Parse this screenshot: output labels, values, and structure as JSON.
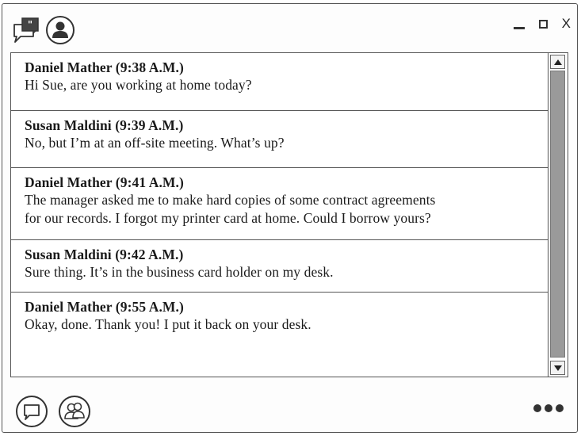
{
  "titlebar": {
    "chat_icon": "speech-bubble-quote-icon",
    "profile_icon": "user-profile-icon",
    "minimize_icon": "minimize-icon",
    "maximize_icon": "maximize-icon",
    "close_label": "X"
  },
  "messages": [
    {
      "sender": "Daniel Mather (9:38 A.M.)",
      "lines": [
        "Hi Sue, are you working at home today?"
      ]
    },
    {
      "sender": "Susan Maldini (9:39 A.M.)",
      "lines": [
        "No, but I’m at an off-site meeting. What’s up?"
      ]
    },
    {
      "sender": "Daniel Mather (9:41 A.M.)",
      "lines": [
        "The manager asked me to make hard copies of some contract agreements",
        "for our records. I forgot my printer card at home. Could I borrow yours?"
      ]
    },
    {
      "sender": "Susan Maldini (9:42 A.M.)",
      "lines": [
        "Sure thing. It’s in the business card holder on my desk."
      ]
    },
    {
      "sender": "Daniel Mather (9:55 A.M.)",
      "lines": [
        "Okay, done. Thank you! I put it back on your desk."
      ]
    }
  ],
  "bottombar": {
    "chat_icon": "chat-bubble-icon",
    "contacts_icon": "contacts-icon",
    "more_icon": "more-options-icon"
  },
  "colors": {
    "border": "#555555",
    "scroll_thumb": "#9a9a9a",
    "background": "#ffffff"
  }
}
